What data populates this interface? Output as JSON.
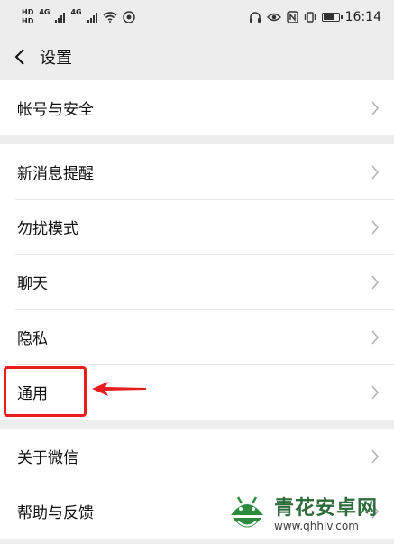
{
  "status_bar": {
    "sim1": "HD",
    "sim2": "HD",
    "network1": "4G",
    "network2": "4G",
    "time": "16:14"
  },
  "header": {
    "title": "设置"
  },
  "groups": [
    {
      "items": [
        {
          "label": "帐号与安全"
        }
      ]
    },
    {
      "items": [
        {
          "label": "新消息提醒"
        },
        {
          "label": "勿扰模式"
        },
        {
          "label": "聊天"
        },
        {
          "label": "隐私"
        },
        {
          "label": "通用"
        }
      ]
    },
    {
      "items": [
        {
          "label": "关于微信"
        },
        {
          "label": "帮助与反馈"
        }
      ]
    }
  ],
  "watermark": {
    "brand": "青花安卓网",
    "url": "www.qhhlv.com"
  },
  "colors": {
    "annotation": "#e81d1d",
    "background": "#ededed",
    "row": "#ffffff"
  }
}
